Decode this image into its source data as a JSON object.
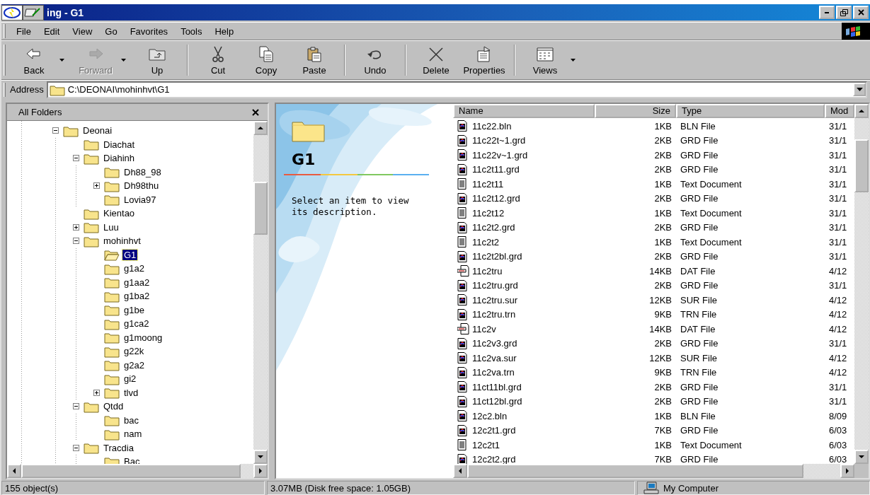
{
  "window": {
    "title": "ing - G1"
  },
  "menu": [
    "File",
    "Edit",
    "View",
    "Go",
    "Favorites",
    "Tools",
    "Help"
  ],
  "toolbar": [
    {
      "label": "Back",
      "disabled": false,
      "dropdown": true,
      "separator_after": false
    },
    {
      "label": "Forward",
      "disabled": true,
      "dropdown": true,
      "separator_after": false
    },
    {
      "label": "Up",
      "disabled": false,
      "dropdown": false,
      "separator_after": true
    },
    {
      "label": "Cut",
      "disabled": false,
      "dropdown": false,
      "separator_after": false
    },
    {
      "label": "Copy",
      "disabled": false,
      "dropdown": false,
      "separator_after": false
    },
    {
      "label": "Paste",
      "disabled": false,
      "dropdown": false,
      "separator_after": true
    },
    {
      "label": "Undo",
      "disabled": false,
      "dropdown": false,
      "separator_after": true
    },
    {
      "label": "Delete",
      "disabled": false,
      "dropdown": false,
      "separator_after": false
    },
    {
      "label": "Properties",
      "disabled": false,
      "dropdown": false,
      "separator_after": true
    },
    {
      "label": "Views",
      "disabled": false,
      "dropdown": true,
      "separator_after": false
    }
  ],
  "address": {
    "label": "Address",
    "value": "C:\\DEONAI\\mohinhvt\\G1"
  },
  "folders_pane": {
    "title": "All Folders",
    "tree": [
      {
        "kind": "branch",
        "label": "Deonai",
        "expanded": true,
        "selected": false,
        "children": [
          {
            "kind": "leaf",
            "label": "Diachat",
            "selected": false
          },
          {
            "kind": "branch",
            "label": "Diahinh",
            "expanded": true,
            "selected": false,
            "children": [
              {
                "kind": "leaf",
                "label": "Dh88_98",
                "selected": false
              },
              {
                "kind": "branch",
                "label": "Dh98thu",
                "expanded": false,
                "selected": false
              },
              {
                "kind": "leaf",
                "label": "Lovia97",
                "selected": false
              }
            ]
          },
          {
            "kind": "leaf",
            "label": "Kientao",
            "selected": false
          },
          {
            "kind": "branch",
            "label": "Luu",
            "expanded": false,
            "selected": false
          },
          {
            "kind": "branch",
            "label": "mohinhvt",
            "expanded": true,
            "selected": false,
            "children": [
              {
                "kind": "leaf",
                "label": "G1",
                "selected": true
              },
              {
                "kind": "leaf",
                "label": "g1a2",
                "selected": false
              },
              {
                "kind": "leaf",
                "label": "g1aa2",
                "selected": false
              },
              {
                "kind": "leaf",
                "label": "g1ba2",
                "selected": false
              },
              {
                "kind": "leaf",
                "label": "g1be",
                "selected": false
              },
              {
                "kind": "leaf",
                "label": "g1ca2",
                "selected": false
              },
              {
                "kind": "leaf",
                "label": "g1moong",
                "selected": false
              },
              {
                "kind": "leaf",
                "label": "g22k",
                "selected": false
              },
              {
                "kind": "leaf",
                "label": "g2a2",
                "selected": false
              },
              {
                "kind": "leaf",
                "label": "gi2",
                "selected": false
              },
              {
                "kind": "branch",
                "label": "tlvd",
                "expanded": false,
                "selected": false
              }
            ]
          },
          {
            "kind": "branch",
            "label": "Qtdd",
            "expanded": true,
            "selected": false,
            "children": [
              {
                "kind": "leaf",
                "label": "bac",
                "selected": false
              },
              {
                "kind": "leaf",
                "label": "nam",
                "selected": false
              }
            ]
          },
          {
            "kind": "branch",
            "label": "Tracdia",
            "expanded": true,
            "selected": false,
            "children": [
              {
                "kind": "leaf",
                "label": "Bac",
                "selected": false
              }
            ]
          }
        ]
      }
    ]
  },
  "web_view": {
    "folder_name": "G1",
    "description": "Select an item to view its description."
  },
  "file_list": {
    "columns": [
      "Name",
      "Size",
      "Type",
      "Mod"
    ],
    "rows": [
      {
        "kind": "app",
        "name": "11c22.bln",
        "size": "1KB",
        "type": "BLN File",
        "modified": "31/1"
      },
      {
        "kind": "app",
        "name": "11c22t~1.grd",
        "size": "2KB",
        "type": "GRD File",
        "modified": "31/1"
      },
      {
        "kind": "app",
        "name": "11c22v~1.grd",
        "size": "2KB",
        "type": "GRD File",
        "modified": "31/1"
      },
      {
        "kind": "app",
        "name": "11c2t11.grd",
        "size": "2KB",
        "type": "GRD File",
        "modified": "31/1"
      },
      {
        "kind": "text",
        "name": "11c2t11",
        "size": "1KB",
        "type": "Text Document",
        "modified": "31/1"
      },
      {
        "kind": "app",
        "name": "11c2t12.grd",
        "size": "2KB",
        "type": "GRD File",
        "modified": "31/1"
      },
      {
        "kind": "text",
        "name": "11c2t12",
        "size": "1KB",
        "type": "Text Document",
        "modified": "31/1"
      },
      {
        "kind": "app",
        "name": "11c2t2.grd",
        "size": "2KB",
        "type": "GRD File",
        "modified": "31/1"
      },
      {
        "kind": "text",
        "name": "11c2t2",
        "size": "1KB",
        "type": "Text Document",
        "modified": "31/1"
      },
      {
        "kind": "app",
        "name": "11c2t2bl.grd",
        "size": "2KB",
        "type": "GRD File",
        "modified": "31/1"
      },
      {
        "kind": "dat",
        "name": "11c2tru",
        "size": "14KB",
        "type": "DAT File",
        "modified": "4/12"
      },
      {
        "kind": "app",
        "name": "11c2tru.grd",
        "size": "2KB",
        "type": "GRD File",
        "modified": "31/1"
      },
      {
        "kind": "app",
        "name": "11c2tru.sur",
        "size": "12KB",
        "type": "SUR File",
        "modified": "4/12"
      },
      {
        "kind": "app",
        "name": "11c2tru.trn",
        "size": "9KB",
        "type": "TRN File",
        "modified": "4/12"
      },
      {
        "kind": "dat",
        "name": "11c2v",
        "size": "14KB",
        "type": "DAT File",
        "modified": "4/12"
      },
      {
        "kind": "app",
        "name": "11c2v3.grd",
        "size": "2KB",
        "type": "GRD File",
        "modified": "31/1"
      },
      {
        "kind": "app",
        "name": "11c2va.sur",
        "size": "12KB",
        "type": "SUR File",
        "modified": "4/12"
      },
      {
        "kind": "app",
        "name": "11c2va.trn",
        "size": "9KB",
        "type": "TRN File",
        "modified": "4/12"
      },
      {
        "kind": "app",
        "name": "11ct11bl.grd",
        "size": "2KB",
        "type": "GRD File",
        "modified": "31/1"
      },
      {
        "kind": "app",
        "name": "11ct12bl.grd",
        "size": "2KB",
        "type": "GRD File",
        "modified": "31/1"
      },
      {
        "kind": "app",
        "name": "12c2.bln",
        "size": "1KB",
        "type": "BLN File",
        "modified": "8/09"
      },
      {
        "kind": "app",
        "name": "12c2t1.grd",
        "size": "7KB",
        "type": "GRD File",
        "modified": "6/03"
      },
      {
        "kind": "text",
        "name": "12c2t1",
        "size": "1KB",
        "type": "Text Document",
        "modified": "6/03"
      },
      {
        "kind": "app",
        "name": "12c2t2.grd",
        "size": "7KB",
        "type": "GRD File",
        "modified": "6/03"
      }
    ]
  },
  "status_bar": {
    "objects": "155 object(s)",
    "disk": "3.07MB (Disk free space: 1.05GB)",
    "location": "My Computer"
  }
}
